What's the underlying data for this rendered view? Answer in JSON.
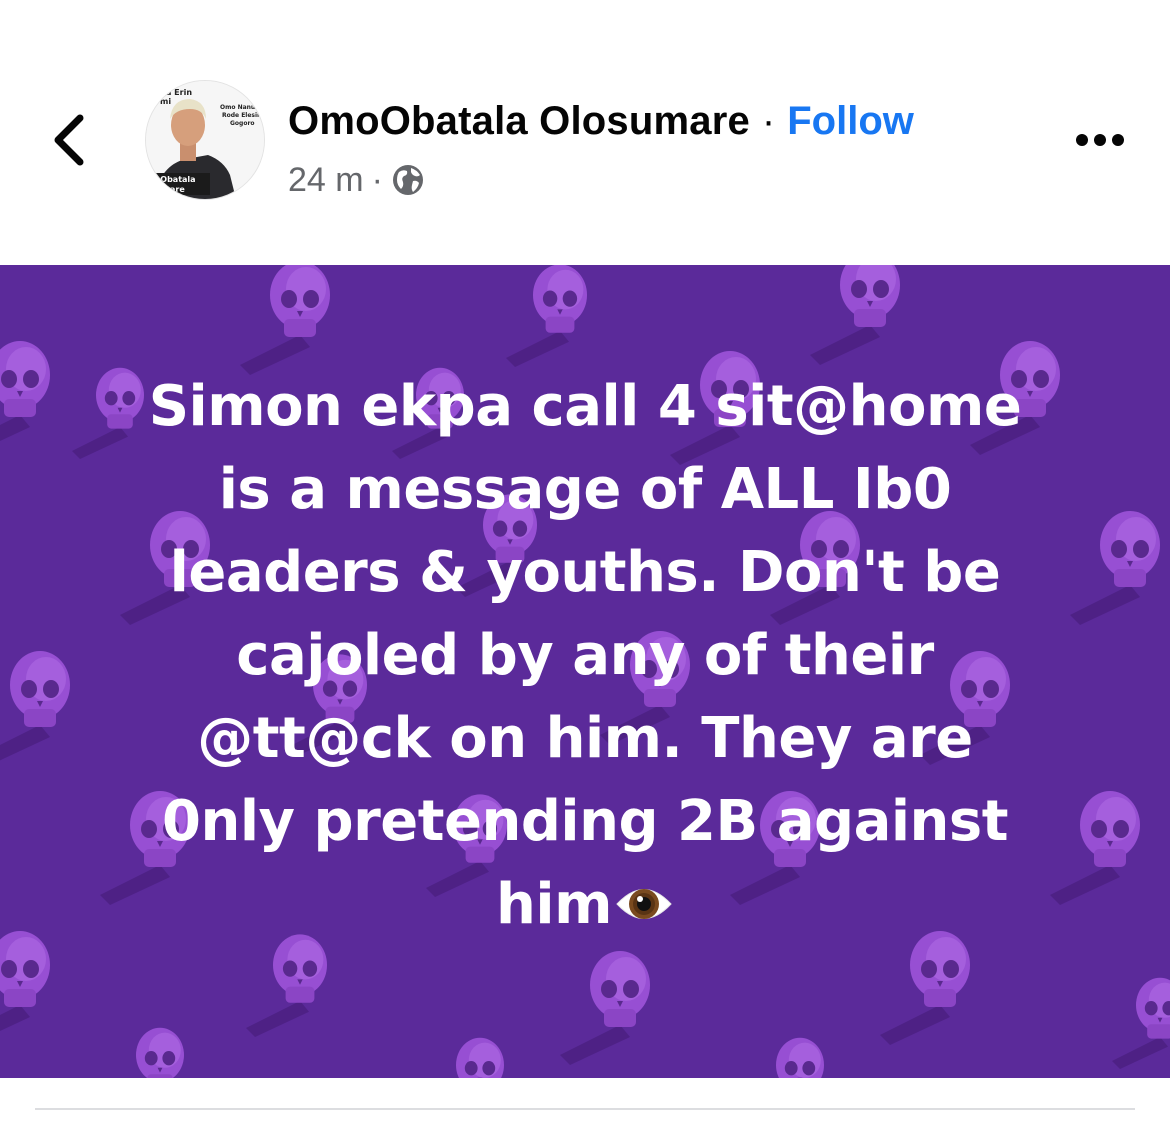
{
  "header": {
    "author_name": "OmoObatala Olosumare",
    "separator": "·",
    "follow_label": "Follow",
    "timestamp": "24 m",
    "meta_separator": "·",
    "privacy_icon": "globe-icon",
    "back_icon": "chevron-left-icon",
    "more_icon": "more-horizontal-icon"
  },
  "avatar": {
    "lettering": [
      "a Erin",
      "mi",
      "Omo Nanu",
      "Rode Elesin",
      "Gogoro",
      "o Obatala",
      "umare"
    ]
  },
  "post": {
    "background_color": "#5b2a9a",
    "text_color": "#ffffff",
    "lines": [
      "Simon ekpa call 4 sit@home",
      "is a message of ALL Ib0",
      "leaders & youths. Don't be",
      "cajoled by any of their",
      "@tt@ck on him. They are",
      "0nly pretending 2B against"
    ],
    "last_line_text": "him",
    "last_line_emoji": "eye-emoji"
  },
  "colors": {
    "follow": "#1877f2",
    "meta": "#65676b",
    "name": "#050505",
    "divider": "#dcdde0"
  }
}
